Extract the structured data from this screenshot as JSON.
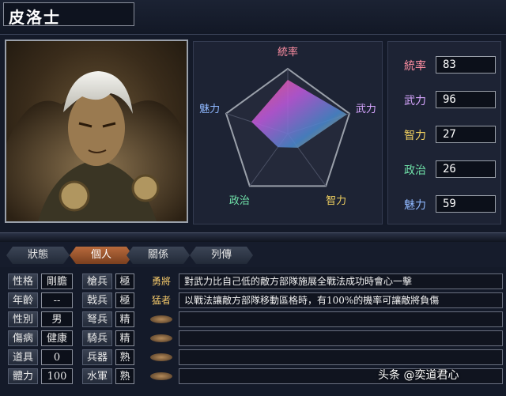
{
  "officer": {
    "name": "皮洛士"
  },
  "radar": {
    "labels": [
      "統率",
      "武力",
      "智力",
      "政治",
      "魅力"
    ],
    "max": 100
  },
  "stats": [
    {
      "label": "統率",
      "value": 83,
      "color": "#ff8fa3"
    },
    {
      "label": "武力",
      "value": 96,
      "color": "#d7a6ff"
    },
    {
      "label": "智力",
      "value": 27,
      "color": "#f0d060"
    },
    {
      "label": "政治",
      "value": 26,
      "color": "#6fe0a8"
    },
    {
      "label": "魅力",
      "value": 59,
      "color": "#8fb8ff"
    }
  ],
  "tabs": [
    {
      "label": "狀態",
      "active": false
    },
    {
      "label": "個人",
      "active": true
    },
    {
      "label": "關係",
      "active": false
    },
    {
      "label": "列傳",
      "active": false
    }
  ],
  "info": {
    "col1": [
      {
        "label": "性格",
        "value": "剛膽"
      },
      {
        "label": "年齡",
        "value": "--"
      },
      {
        "label": "性別",
        "value": "男"
      },
      {
        "label": "傷病",
        "value": "健康"
      },
      {
        "label": "道具",
        "value": "0"
      },
      {
        "label": "體力",
        "value": "100"
      }
    ],
    "col2": [
      {
        "label": "槍兵",
        "value": "極"
      },
      {
        "label": "戟兵",
        "value": "極"
      },
      {
        "label": "弩兵",
        "value": "精"
      },
      {
        "label": "騎兵",
        "value": "精"
      },
      {
        "label": "兵器",
        "value": "熟"
      },
      {
        "label": "水軍",
        "value": "熟"
      }
    ]
  },
  "skills": [
    {
      "name": "勇將",
      "desc": "對武力比自己低的敵方部隊施展全戰法成功時會心一擊"
    },
    {
      "name": "猛者",
      "desc": "以戰法讓敵方部隊移動區格時，有100%的機率可讓敵將負傷"
    }
  ],
  "watermark": "头条 @奕道君心",
  "colors": {
    "tab_active": "#b86a3c",
    "skill_name": "#f3c86a"
  }
}
